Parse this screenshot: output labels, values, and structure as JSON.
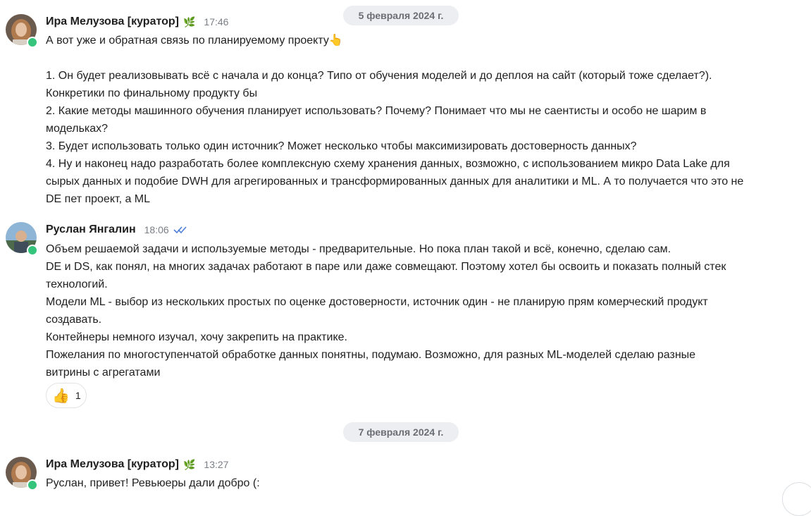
{
  "dates": [
    "5 февраля 2024 г.",
    "7 февраля 2024 г."
  ],
  "messages": [
    {
      "author": "Ира Мелузова [куратор]",
      "time": "17:46",
      "lines": [
        "А вот уже и обратная связь по планируемому проекту👆",
        "",
        "1. Он будет реализовывать всё с начала и до конца? Типо от обучения моделей и до деплоя на сайт (который тоже сделает?).",
        "Конкретики по финальному продукту бы",
        "2. Какие методы машинного обучения планирует использовать? Почему? Понимает что мы не саентисты и особо не шарим в",
        "модельках?",
        "3. Будет использовать только один источник? Может несколько чтобы максимизировать достоверность данных?",
        "4. Ну и наконец надо разработать более комплексную схему хранения данных, возможно, с использованием микро Data Lake для",
        "сырых данных и подобие DWH для агрегированных и трансформированных данных для аналитики и ML. А то получается что это не",
        "DE пет проект, а ML"
      ]
    },
    {
      "author": "Руслан Янгалин",
      "time": "18:06",
      "lines": [
        "Объем решаемой задачи и используемые методы - предварительные. Но пока план такой и всё, конечно, сделаю сам.",
        "DE и DS, как понял, на многих задачах работают в паре или даже совмещают. Поэтому хотел бы освоить и показать полный стек",
        "технологий.",
        "Модели ML - выбор из нескольких простых по оценке достоверности, источник один - не планирую прям комерческий продукт",
        "создавать.",
        "Контейнеры немного изучал, хочу закрепить на практике.",
        "Пожелания по многоступенчатой обработке данных понятны, подумаю. Возможно, для разных ML-моделей сделаю разные",
        "витрины с агрегатами"
      ],
      "reaction": {
        "emoji": "👍",
        "count": "1"
      }
    },
    {
      "author": "Ира Мелузова [куратор]",
      "time": "13:27",
      "lines": [
        "Руслан, привет! Ревьюеры дали добро (:"
      ]
    }
  ],
  "colors": {
    "online": "#34c47c",
    "check": "#4f7fd9",
    "leaf": "#4caf50"
  }
}
